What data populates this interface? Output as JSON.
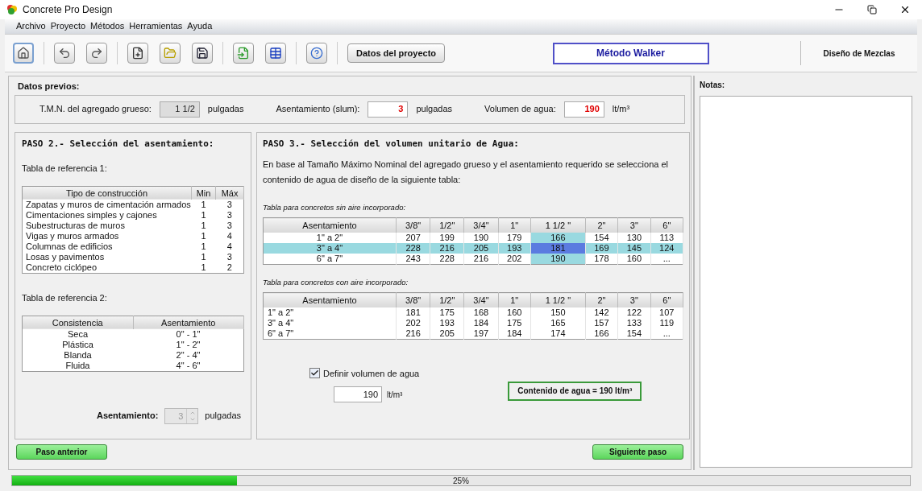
{
  "window": {
    "title": "Concrete Pro Design"
  },
  "menu": [
    "Archivo",
    "Proyecto",
    "Métodos",
    "Herramientas",
    "Ayuda"
  ],
  "toolbar": [
    {
      "kind": "home",
      "selected": true
    },
    {
      "kind": "undo",
      "selected": false
    },
    {
      "kind": "redo",
      "selected": false
    },
    {
      "kind": "new",
      "selected": false
    },
    {
      "kind": "open",
      "selected": false
    },
    {
      "kind": "save",
      "selected": false
    },
    {
      "kind": "export",
      "selected": false
    },
    {
      "kind": "table",
      "selected": false
    },
    {
      "kind": "help",
      "selected": false
    }
  ],
  "project_button": "Datos del proyecto",
  "method_title": "Método Walker",
  "section_title": "Diseño de Mezclas",
  "previous_data": {
    "title": "Datos previos:",
    "fields": [
      {
        "label": "T.M.N. del agregado grueso:",
        "value": "1 1/2",
        "unit": "pulgadas",
        "readonly": true
      },
      {
        "label": "Asentamiento (slum):",
        "value": "3",
        "unit": "pulgadas",
        "readonly": false
      },
      {
        "label": "Volumen de agua:",
        "value": "190",
        "unit": "lt/m³",
        "readonly": false
      }
    ]
  },
  "step2": {
    "title": "PASO 2.- Selección del asentamiento:",
    "table1_caption": "Tabla de referencia 1:",
    "table1": {
      "columns": [
        "Tipo de construcción",
        "Min",
        "Máx"
      ],
      "rows": [
        [
          "Zapatas y muros de cimentación armados",
          "1",
          "3"
        ],
        [
          "Cimentaciones simples y cajones",
          "1",
          "3"
        ],
        [
          "Subestructuras de muros",
          "1",
          "3"
        ],
        [
          "Vigas y muros armados",
          "1",
          "4"
        ],
        [
          "Columnas de edificios",
          "1",
          "4"
        ],
        [
          "Losas y pavimentos",
          "1",
          "3"
        ],
        [
          "Concreto ciclópeo",
          "1",
          "2"
        ]
      ]
    },
    "table2_caption": "Tabla de referencia 2:",
    "table2": {
      "columns": [
        "Consistencia",
        "Asentamiento"
      ],
      "rows": [
        [
          "Seca",
          "0\" - 1\""
        ],
        [
          "Plástica",
          "1\" - 2\""
        ],
        [
          "Blanda",
          "2\" - 4\""
        ],
        [
          "Fluida",
          "4\" - 6\""
        ]
      ]
    },
    "spinner": {
      "label": "Asentamiento:",
      "value": "3",
      "unit": "pulgadas",
      "disabled": true
    }
  },
  "step3": {
    "title": "PASO 3.- Selección del volumen unitario de Agua:",
    "description": "En base al Tamaño Máximo Nominal del agregado grueso y el asentamiento requerido se selecciona el contenido de agua de diseño de la siguiente tabla:",
    "table_a_caption": "Tabla para concretos sin aire incorporado:",
    "table_a": {
      "columns": [
        {
          "label": "Asentamiento",
          "selected": false
        },
        {
          "label": "3/8\"",
          "selected": false
        },
        {
          "label": "1/2\"",
          "selected": false
        },
        {
          "label": "3/4\"",
          "selected": false
        },
        {
          "label": "1\"",
          "selected": false
        },
        {
          "label": "1 1/2 \"",
          "selected": true
        },
        {
          "label": "2\"",
          "selected": false
        },
        {
          "label": "3\"",
          "selected": false
        },
        {
          "label": "6\"",
          "selected": false
        }
      ],
      "rows": [
        {
          "selected": false,
          "cells": [
            "1\" a 2\"",
            "207",
            "199",
            "190",
            "179",
            "166",
            "154",
            "130",
            "113"
          ]
        },
        {
          "selected": true,
          "cells": [
            "3\" a 4\"",
            "228",
            "216",
            "205",
            "193",
            "181",
            "169",
            "145",
            "124"
          ]
        },
        {
          "selected": false,
          "cells": [
            "6\" a 7\"",
            "243",
            "228",
            "216",
            "202",
            "190",
            "178",
            "160",
            "..."
          ]
        }
      ]
    },
    "table_b_caption": "Tabla para concretos con aire incorporado:",
    "table_b": {
      "columns": [
        {
          "label": "Asentamiento",
          "selected": false
        },
        {
          "label": "3/8\"",
          "selected": false
        },
        {
          "label": "1/2\"",
          "selected": false
        },
        {
          "label": "3/4\"",
          "selected": false
        },
        {
          "label": "1\"",
          "selected": false
        },
        {
          "label": "1 1/2 \"",
          "selected": false
        },
        {
          "label": "2\"",
          "selected": false
        },
        {
          "label": "3\"",
          "selected": false
        },
        {
          "label": "6\"",
          "selected": false
        }
      ],
      "rows": [
        {
          "selected": false,
          "cells": [
            "1\" a 2\"",
            "181",
            "175",
            "168",
            "160",
            "150",
            "142",
            "122",
            "107"
          ]
        },
        {
          "selected": false,
          "cells": [
            "3\" a 4\"",
            "202",
            "193",
            "184",
            "175",
            "165",
            "157",
            "133",
            "119"
          ]
        },
        {
          "selected": false,
          "cells": [
            "6\" a 7\"",
            "216",
            "205",
            "197",
            "184",
            "174",
            "166",
            "154",
            "..."
          ]
        }
      ]
    },
    "checkbox": {
      "label": "Definir volumen de agua",
      "checked": true
    },
    "water_field": {
      "value": "190",
      "unit": "lt/m³"
    },
    "result": "Contenido de agua = 190 lt/m³"
  },
  "nav": {
    "previous": "Paso anterior",
    "next": "Siguiente paso"
  },
  "notes": {
    "title": "Notas:"
  },
  "progress": {
    "level": 0.25,
    "text": "25%"
  }
}
